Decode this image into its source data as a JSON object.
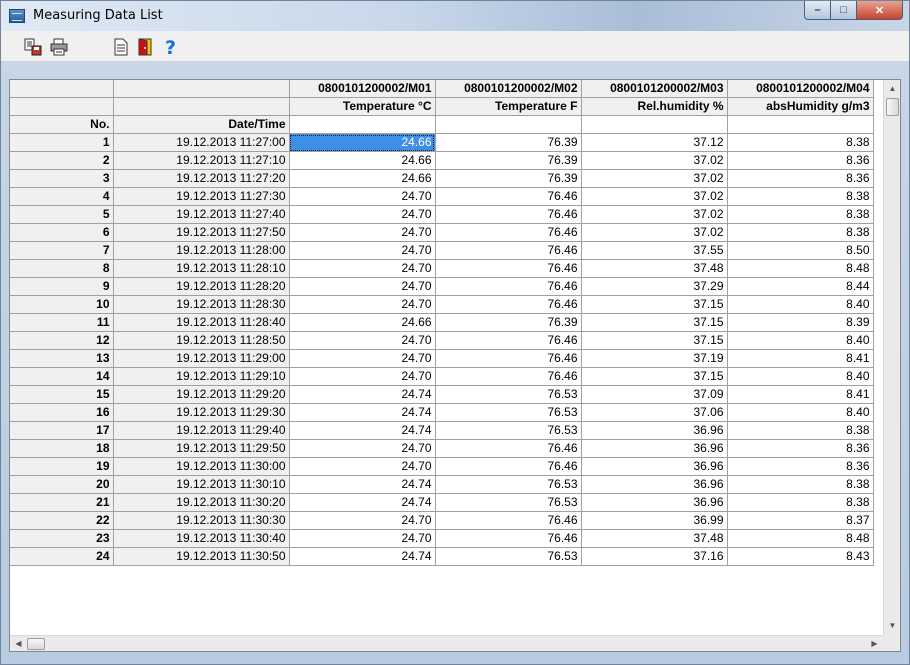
{
  "window": {
    "title": "Measuring Data List"
  },
  "toolbar": {
    "icons": [
      "export-icon",
      "print-icon",
      "document-icon",
      "exit-icon",
      "help-icon"
    ]
  },
  "table": {
    "header_row1": [
      "",
      "",
      "0800101200002/M01",
      "0800101200002/M02",
      "0800101200002/M03",
      "0800101200002/M04"
    ],
    "header_row2": [
      "",
      "",
      "Temperature °C",
      "Temperature F",
      "Rel.humidity %",
      "absHumidity g/m3"
    ],
    "header_row3": [
      "No.",
      "Date/Time",
      "",
      "",
      "",
      ""
    ],
    "rows": [
      [
        "1",
        "19.12.2013 11:27:00",
        "24.66",
        "76.39",
        "37.12",
        "8.38"
      ],
      [
        "2",
        "19.12.2013 11:27:10",
        "24.66",
        "76.39",
        "37.02",
        "8.36"
      ],
      [
        "3",
        "19.12.2013 11:27:20",
        "24.66",
        "76.39",
        "37.02",
        "8.36"
      ],
      [
        "4",
        "19.12.2013 11:27:30",
        "24.70",
        "76.46",
        "37.02",
        "8.38"
      ],
      [
        "5",
        "19.12.2013 11:27:40",
        "24.70",
        "76.46",
        "37.02",
        "8.38"
      ],
      [
        "6",
        "19.12.2013 11:27:50",
        "24.70",
        "76.46",
        "37.02",
        "8.38"
      ],
      [
        "7",
        "19.12.2013 11:28:00",
        "24.70",
        "76.46",
        "37.55",
        "8.50"
      ],
      [
        "8",
        "19.12.2013 11:28:10",
        "24.70",
        "76.46",
        "37.48",
        "8.48"
      ],
      [
        "9",
        "19.12.2013 11:28:20",
        "24.70",
        "76.46",
        "37.29",
        "8.44"
      ],
      [
        "10",
        "19.12.2013 11:28:30",
        "24.70",
        "76.46",
        "37.15",
        "8.40"
      ],
      [
        "11",
        "19.12.2013 11:28:40",
        "24.66",
        "76.39",
        "37.15",
        "8.39"
      ],
      [
        "12",
        "19.12.2013 11:28:50",
        "24.70",
        "76.46",
        "37.15",
        "8.40"
      ],
      [
        "13",
        "19.12.2013 11:29:00",
        "24.70",
        "76.46",
        "37.19",
        "8.41"
      ],
      [
        "14",
        "19.12.2013 11:29:10",
        "24.70",
        "76.46",
        "37.15",
        "8.40"
      ],
      [
        "15",
        "19.12.2013 11:29:20",
        "24.74",
        "76.53",
        "37.09",
        "8.41"
      ],
      [
        "16",
        "19.12.2013 11:29:30",
        "24.74",
        "76.53",
        "37.06",
        "8.40"
      ],
      [
        "17",
        "19.12.2013 11:29:40",
        "24.74",
        "76.53",
        "36.96",
        "8.38"
      ],
      [
        "18",
        "19.12.2013 11:29:50",
        "24.70",
        "76.46",
        "36.96",
        "8.36"
      ],
      [
        "19",
        "19.12.2013 11:30:00",
        "24.70",
        "76.46",
        "36.96",
        "8.36"
      ],
      [
        "20",
        "19.12.2013 11:30:10",
        "24.74",
        "76.53",
        "36.96",
        "8.38"
      ],
      [
        "21",
        "19.12.2013 11:30:20",
        "24.74",
        "76.53",
        "36.96",
        "8.38"
      ],
      [
        "22",
        "19.12.2013 11:30:30",
        "24.70",
        "76.46",
        "36.99",
        "8.37"
      ],
      [
        "23",
        "19.12.2013 11:30:40",
        "24.70",
        "76.46",
        "37.48",
        "8.48"
      ],
      [
        "24",
        "19.12.2013 11:30:50",
        "24.74",
        "76.53",
        "37.16",
        "8.43"
      ]
    ],
    "selected_row": 0,
    "selected_col": 2
  },
  "colors": {
    "selection": "#3f8ee8",
    "header_bg": "#f0f0f0",
    "grid_line": "#a0a0a0"
  }
}
